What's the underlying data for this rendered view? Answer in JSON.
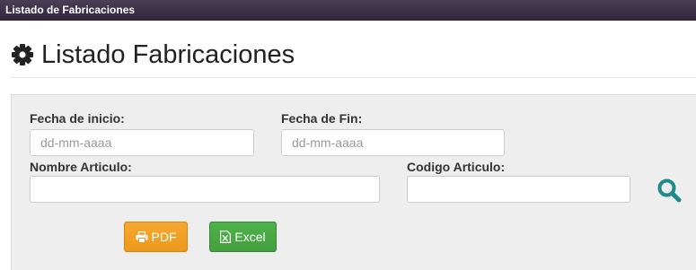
{
  "window": {
    "title": "Listado de Fabricaciones"
  },
  "header": {
    "title": "Listado Fabricaciones",
    "icon": "gear-icon"
  },
  "filters": {
    "fecha_inicio": {
      "label": "Fecha de inicio:",
      "placeholder": "dd-mm-aaaa",
      "value": ""
    },
    "fecha_fin": {
      "label": "Fecha de Fin:",
      "placeholder": "dd-mm-aaaa",
      "value": ""
    },
    "nombre_articulo": {
      "label": "Nombre Articulo:",
      "value": ""
    },
    "codigo_articulo": {
      "label": "Codigo Articulo:",
      "value": ""
    }
  },
  "actions": {
    "search_icon": "search-icon",
    "pdf_label": "PDF",
    "excel_label": "Excel"
  },
  "colors": {
    "titlebar": "#3a2f45",
    "pdf_button": "#f0a030",
    "excel_button": "#47a843",
    "search_icon": "#1f8a8a"
  }
}
